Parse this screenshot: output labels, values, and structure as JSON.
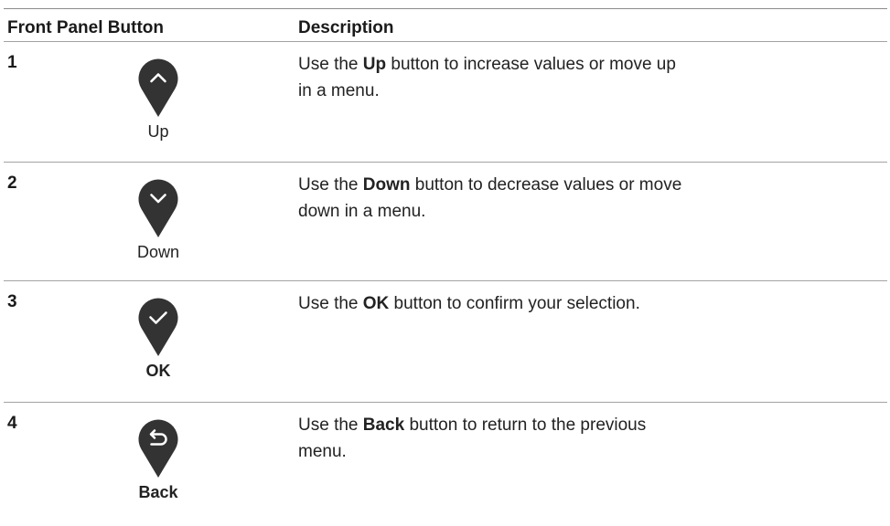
{
  "table": {
    "headers": {
      "button": "Front Panel Button",
      "description": "Description"
    },
    "rows": [
      {
        "number": "1",
        "icon": "chevron-up-icon",
        "caption": "Up",
        "desc_pre": "Use the ",
        "desc_bold": "Up",
        "desc_post": " button to increase values or move up in a menu."
      },
      {
        "number": "2",
        "icon": "chevron-down-icon",
        "caption": "Down",
        "desc_pre": "Use the ",
        "desc_bold": "Down",
        "desc_post": " button to decrease values or move down in a menu."
      },
      {
        "number": "3",
        "icon": "checkmark-icon",
        "caption": "OK",
        "desc_pre": "Use the ",
        "desc_bold": "OK",
        "desc_post": " button to confirm your selection."
      },
      {
        "number": "4",
        "icon": "back-arrow-icon",
        "caption": "Back",
        "desc_pre": "Use the ",
        "desc_bold": "Back",
        "desc_post": " button to return to the previous menu."
      }
    ]
  },
  "colors": {
    "icon_fill": "#333333",
    "icon_glyph": "#ffffff",
    "rule": "#a3a3a3"
  }
}
